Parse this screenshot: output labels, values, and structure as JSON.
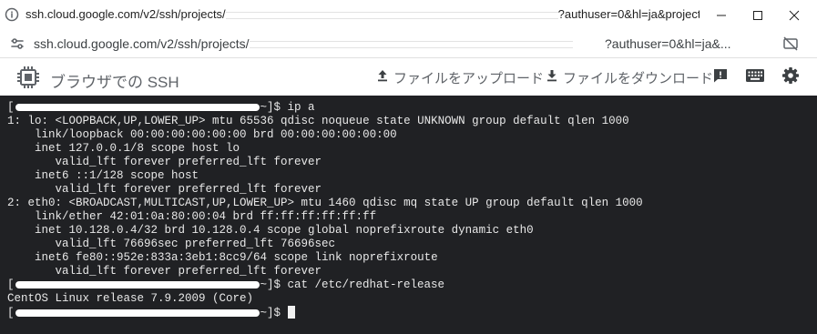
{
  "window": {
    "title_prefix": "ssh.cloud.google.com/v2/ssh/projects/",
    "title_suffix": "?authuser=0&hl=ja&project...",
    "minimize_label": "—",
    "maximize_label": "☐",
    "close_label": "✕"
  },
  "address_bar": {
    "url_prefix": "ssh.cloud.google.com/v2/ssh/projects/",
    "url_suffix": "?authuser=0&hl=ja&..."
  },
  "toolbar": {
    "app_title": "ブラウザでの SSH",
    "upload_label": "ファイルをアップロード",
    "download_label": "ファイルをダウンロード"
  },
  "terminal": {
    "lines": [
      {
        "prompt": true,
        "open": "[",
        "close": "~]$ ",
        "text": "ip a"
      },
      {
        "prompt": false,
        "text": "1: lo: <LOOPBACK,UP,LOWER_UP> mtu 65536 qdisc noqueue state UNKNOWN group default qlen 1000"
      },
      {
        "prompt": false,
        "text": "    link/loopback 00:00:00:00:00:00 brd 00:00:00:00:00:00"
      },
      {
        "prompt": false,
        "text": "    inet 127.0.0.1/8 scope host lo"
      },
      {
        "prompt": false,
        "text": "       valid_lft forever preferred_lft forever"
      },
      {
        "prompt": false,
        "text": "    inet6 ::1/128 scope host"
      },
      {
        "prompt": false,
        "text": "       valid_lft forever preferred_lft forever"
      },
      {
        "prompt": false,
        "text": "2: eth0: <BROADCAST,MULTICAST,UP,LOWER_UP> mtu 1460 qdisc mq state UP group default qlen 1000"
      },
      {
        "prompt": false,
        "text": "    link/ether 42:01:0a:80:00:04 brd ff:ff:ff:ff:ff:ff"
      },
      {
        "prompt": false,
        "text": "    inet 10.128.0.4/32 brd 10.128.0.4 scope global noprefixroute dynamic eth0"
      },
      {
        "prompt": false,
        "text": "       valid_lft 76696sec preferred_lft 76696sec"
      },
      {
        "prompt": false,
        "text": "    inet6 fe80::952e:833a:3eb1:8cc9/64 scope link noprefixroute"
      },
      {
        "prompt": false,
        "text": "       valid_lft forever preferred_lft forever"
      },
      {
        "prompt": true,
        "open": "[",
        "close": "~]$ ",
        "text": "cat /etc/redhat-release"
      },
      {
        "prompt": false,
        "text": "CentOS Linux release 7.9.2009 (Core)"
      },
      {
        "prompt": true,
        "open": "[",
        "close": "~]$ ",
        "text": "",
        "cursor": true
      }
    ]
  },
  "icons": {
    "site_icon": "site-info-icon",
    "chip": "chip-icon",
    "upload": "upload-icon",
    "download": "download-icon",
    "feedback": "feedback-icon",
    "keyboard": "keyboard-icon",
    "settings": "gear-icon",
    "eye_off": "eye-off-icon"
  },
  "colors": {
    "terminal_bg": "#202124",
    "terminal_fg": "#e8e8e8",
    "toolbar_text": "#5f6368"
  }
}
